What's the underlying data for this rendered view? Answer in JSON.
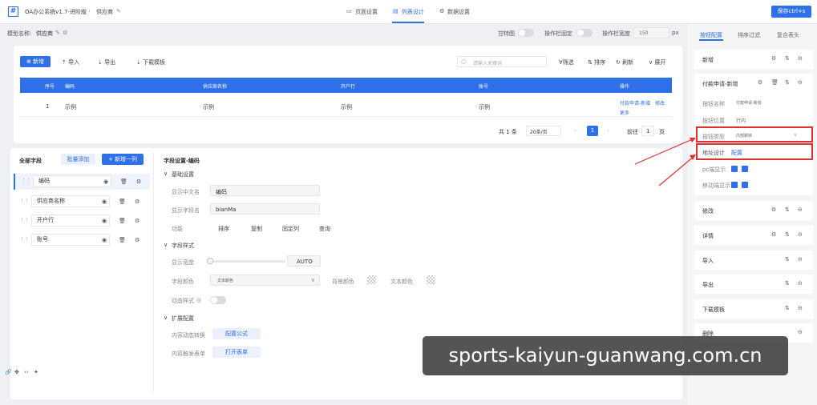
{
  "app": {
    "title": "OA办公系统v1.7-进阶版",
    "page": "供应商",
    "tabs": [
      "页面设置",
      "列表设计",
      "数据设置"
    ],
    "save_label": "保存ctrl+s"
  },
  "model": {
    "label": "模型名称:",
    "name": "供应商",
    "toggles": [
      "甘特图",
      "操作栏固定"
    ],
    "width_label": "操作栏宽度",
    "width_value": "150",
    "width_unit": "px"
  },
  "toolbar": {
    "add": "新增",
    "import": "导入",
    "export": "导出",
    "download": "下载模板",
    "search_placeholder": "请输入关键词",
    "filter": "筛选",
    "sort": "排序",
    "refresh": "刷新",
    "expand": "展开"
  },
  "table": {
    "headers": [
      "序号",
      "编码",
      "供应商名称",
      "开户行",
      "账号",
      "操作"
    ],
    "row": {
      "index": "1",
      "code": "示例",
      "name": "示例",
      "bank": "示例",
      "account": "示例",
      "op1": "付款申请-新增",
      "op2": "修改",
      "op3": "更多"
    },
    "pagination": {
      "total": "共 1 条",
      "per_page": "20条/页",
      "current": "1",
      "goto": "前往",
      "goto_value": "1",
      "page_suffix": "页"
    }
  },
  "fields": {
    "title": "全部字段",
    "batch_add": "批量添加",
    "add_column": "新增一列",
    "items": [
      "编码",
      "供应商名称",
      "开户行",
      "账号"
    ]
  },
  "settings": {
    "title": "字段设置-编码",
    "basic": {
      "title": "基础设置",
      "display_name_label": "显示中文名",
      "display_name_value": "编码",
      "field_name_label": "显示字段名",
      "field_name_value": "bianMa",
      "features_label": "功能",
      "features": [
        "排序",
        "复制",
        "固定列",
        "查询"
      ]
    },
    "style": {
      "title": "字段样式",
      "width_label": "显示宽度",
      "width_value": "AUTO",
      "color_label": "字段颜色",
      "color_value": "文本颜色",
      "bg_label": "背景颜色",
      "text_label": "文本颜色",
      "dynamic_label": "动态样式"
    },
    "extend": {
      "title": "扩展配置",
      "convert_label": "内容动态转换",
      "convert_btn": "配置公式",
      "trigger_label": "内容触发表单",
      "trigger_btn": "打开表单"
    }
  },
  "right_panel": {
    "tabs": [
      "按钮配置",
      "排序过滤",
      "复合表头"
    ],
    "items_top": [
      "新增",
      "付款申请-新增"
    ],
    "detail": {
      "name_label": "按钮名称",
      "name_value": "付款申请-新增",
      "position_label": "按钮位置",
      "position_value": "行内",
      "type_label": "按钮类型",
      "type_value": "内部跳转",
      "addr_label": "地址设计",
      "addr_value": "配置",
      "pc_label": "pc端显示",
      "mobile_label": "移动端显示"
    },
    "items_bottom": [
      "修改",
      "详情",
      "导入",
      "导出",
      "下载模板",
      "删除"
    ]
  },
  "watermark": "sports-kaiyun-guanwang.com.cn",
  "colors": {
    "accent": "#2f6fe8",
    "highlight": "#e03131"
  }
}
